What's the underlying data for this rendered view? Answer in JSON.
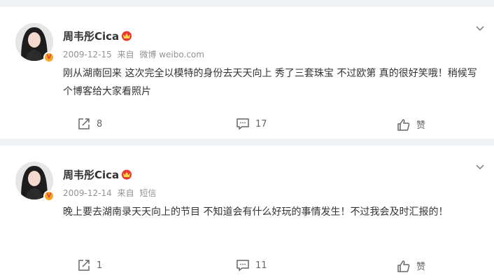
{
  "posts": [
    {
      "author": "周韦彤Cica",
      "date": "2009-12-15",
      "source_prefix": "来自",
      "source": "微博 weibo.com",
      "text": "刚从湖南回来 这次完全以模特的身份去天天向上 秀了三套珠宝 不过欧第 真的很好笑哦！稍候写个博客给大家看照片",
      "share_count": "8",
      "comment_count": "17",
      "like_label": "赞"
    },
    {
      "author": "周韦彤Cica",
      "date": "2009-12-14",
      "source_prefix": "来自",
      "source": "短信",
      "text": "晚上要去湖南录天天向上的节目 不知道会有什么好玩的事情发生！不过我会及时汇报的！",
      "share_count": "1",
      "comment_count": "11",
      "like_label": "赞"
    }
  ],
  "icons": {
    "verified": "verified-badge-icon",
    "vip": "vip-crown-icon",
    "menu": "chevron-down-icon",
    "share": "share-icon",
    "comment": "comment-icon",
    "like": "thumbs-up-icon"
  },
  "colors": {
    "background": "#f1f2f5",
    "card": "#ffffff",
    "meta": "#939393",
    "badge": "#f5a623",
    "vip": "#e8382c"
  }
}
